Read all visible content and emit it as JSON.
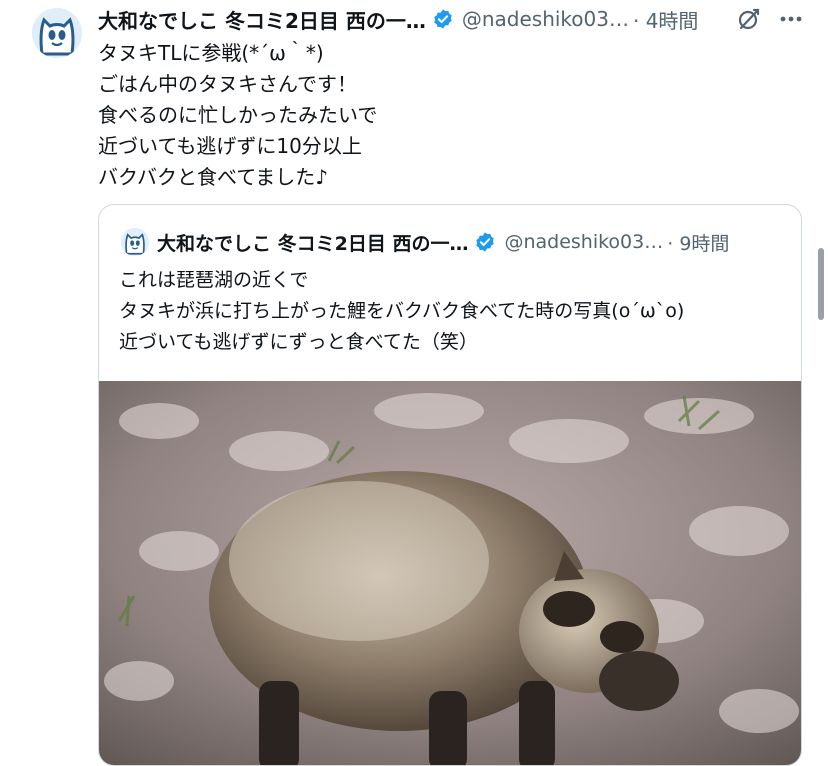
{
  "tweet": {
    "display_name": "大和なでしこ 冬コミ2日目 西の一…",
    "handle": "@nadeshiko03…",
    "time": "· 4時間",
    "text": "タヌキTLに参戦(*´ω｀*)\nごはん中のタヌキさんです！\n食べるのに忙しかったみたいで\n近づいても逃げずに10分以上\nバクバクと食べてました♪"
  },
  "quoted": {
    "display_name": "大和なでしこ 冬コミ2日目 西の一…",
    "handle": "@nadeshiko03…",
    "time": "· 9時間",
    "text": "これは琵琶湖の近くで\nタヌキが浜に打ち上がった鯉をバクバク食べてた時の写真(o´ω`o)\n近づいても逃げずにずっと食べてた（笑）"
  },
  "colors": {
    "verified": "#1d9bf0",
    "secondary_text": "#536471",
    "border": "#cfd9de",
    "avatar_bg": "#dfeef9"
  }
}
